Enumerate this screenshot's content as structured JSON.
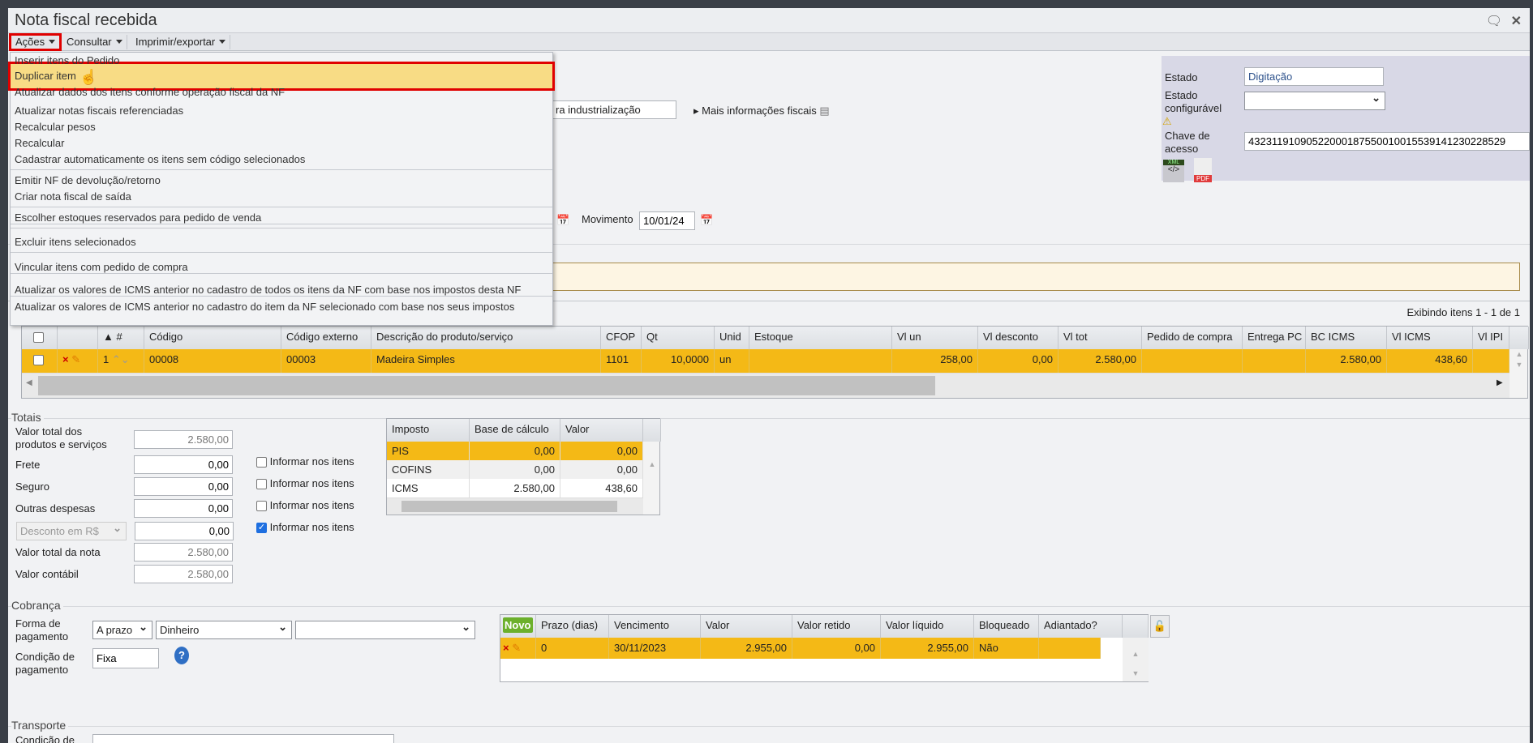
{
  "window": {
    "title": "Nota fiscal recebida",
    "icons": [
      "chat-icon",
      "close-icon"
    ]
  },
  "toolbar": {
    "acoes": "Ações",
    "consultar": "Consultar",
    "imprimir": "Imprimir/exportar"
  },
  "menu": {
    "items": [
      "Inserir itens do Pedido",
      "Duplicar item",
      "Atualizar dados dos itens conforme operação fiscal da NF",
      "Atualizar notas fiscais referenciadas",
      "Recalcular pesos",
      "Recalcular",
      "Cadastrar automaticamente os itens sem código selecionados",
      "Emitir NF de devolução/retorno",
      "Criar nota fiscal de saída",
      "Escolher estoques reservados para pedido de venda",
      "Excluir itens selecionados",
      "Vincular itens com pedido de compra",
      "Atualizar os valores de ICMS anterior no cadastro de todos os itens da NF com base nos impostos desta NF",
      "Atualizar os valores de ICMS anterior no cadastro do item da NF selecionado com base nos seus impostos"
    ],
    "highlighted": "Duplicar item"
  },
  "header": {
    "operacao_partial": "ra industrialização",
    "mais_info": "Mais informações fiscais",
    "movimento_label": "Movimento",
    "movimento_value": "10/01/24"
  },
  "status_panel": {
    "estado_label": "Estado",
    "estado_value": "Digitação",
    "estado_config_label": "Estado configurável",
    "estado_config_value": "",
    "chave_label": "Chave de acesso",
    "chave_value": "43231191090522000187550010015539141230228529",
    "xml_label": "XML",
    "pdf_label": "PDF"
  },
  "items_grid": {
    "count_text": "Exibindo itens 1 - 1 de 1",
    "columns": [
      "",
      "",
      "▲ #",
      "Código",
      "Código externo",
      "Descrição do produto/serviço",
      "CFOP",
      "Qt",
      "Unid",
      "Estoque",
      "Vl un",
      "Vl desconto",
      "Vl tot",
      "Pedido de compra",
      "Entrega PC",
      "BC ICMS",
      "Vl ICMS",
      "Vl IPI"
    ],
    "rows": [
      {
        "num": "1",
        "codigo": "00008",
        "codigo_externo": "00003",
        "descricao": "Madeira Simples",
        "cfop": "1101",
        "qt": "10,0000",
        "unid": "un",
        "estoque": "",
        "vl_un": "258,00",
        "vl_desconto": "0,00",
        "vl_tot": "2.580,00",
        "pedido_compra": "",
        "entrega_pc": "",
        "bc_icms": "2.580,00",
        "vl_icms": "438,60",
        "vl_ipi": ""
      }
    ]
  },
  "totais": {
    "title": "Totais",
    "valor_produtos_label": "Valor total dos produtos e serviços",
    "valor_produtos": "2.580,00",
    "frete_label": "Frete",
    "frete": "0,00",
    "seguro_label": "Seguro",
    "seguro": "0,00",
    "outras_label": "Outras despesas",
    "outras": "0,00",
    "desconto_select": "Desconto em R$",
    "desconto": "0,00",
    "valor_nota_label": "Valor total da nota",
    "valor_nota": "2.580,00",
    "valor_contabil_label": "Valor contábil",
    "valor_contabil": "2.580,00",
    "informar_label": "Informar nos itens",
    "informar_checked": [
      false,
      false,
      false,
      true
    ]
  },
  "impostos": {
    "columns": [
      "Imposto",
      "Base de cálculo",
      "Valor"
    ],
    "rows": [
      {
        "imposto": "PIS",
        "base": "0,00",
        "valor": "0,00"
      },
      {
        "imposto": "COFINS",
        "base": "0,00",
        "valor": "0,00"
      },
      {
        "imposto": "ICMS",
        "base": "2.580,00",
        "valor": "438,60"
      }
    ]
  },
  "cobranca": {
    "title": "Cobrança",
    "forma_label": "Forma de pagamento",
    "forma_value": "A prazo",
    "meio_value": "Dinheiro",
    "extra_value": "",
    "condicao_label": "Condição de pagamento",
    "condicao_value": "Fixa",
    "novo": "Novo",
    "columns": [
      "Prazo (dias)",
      "Vencimento",
      "Valor",
      "Valor retido",
      "Valor líquido",
      "Bloqueado",
      "Adiantado?"
    ],
    "rows": [
      {
        "prazo": "0",
        "vencimento": "30/11/2023",
        "valor": "2.955,00",
        "retido": "0,00",
        "liquido": "2.955,00",
        "bloqueado": "Não",
        "adiantado": ""
      }
    ]
  },
  "transporte": {
    "title": "Transporte",
    "condicao_label": "Condição de"
  },
  "colors": {
    "accent_yellow": "#f4b916",
    "menu_highlight": "#f8dc85",
    "annotation_red": "#e00000",
    "panel": "#d8d8e6"
  }
}
